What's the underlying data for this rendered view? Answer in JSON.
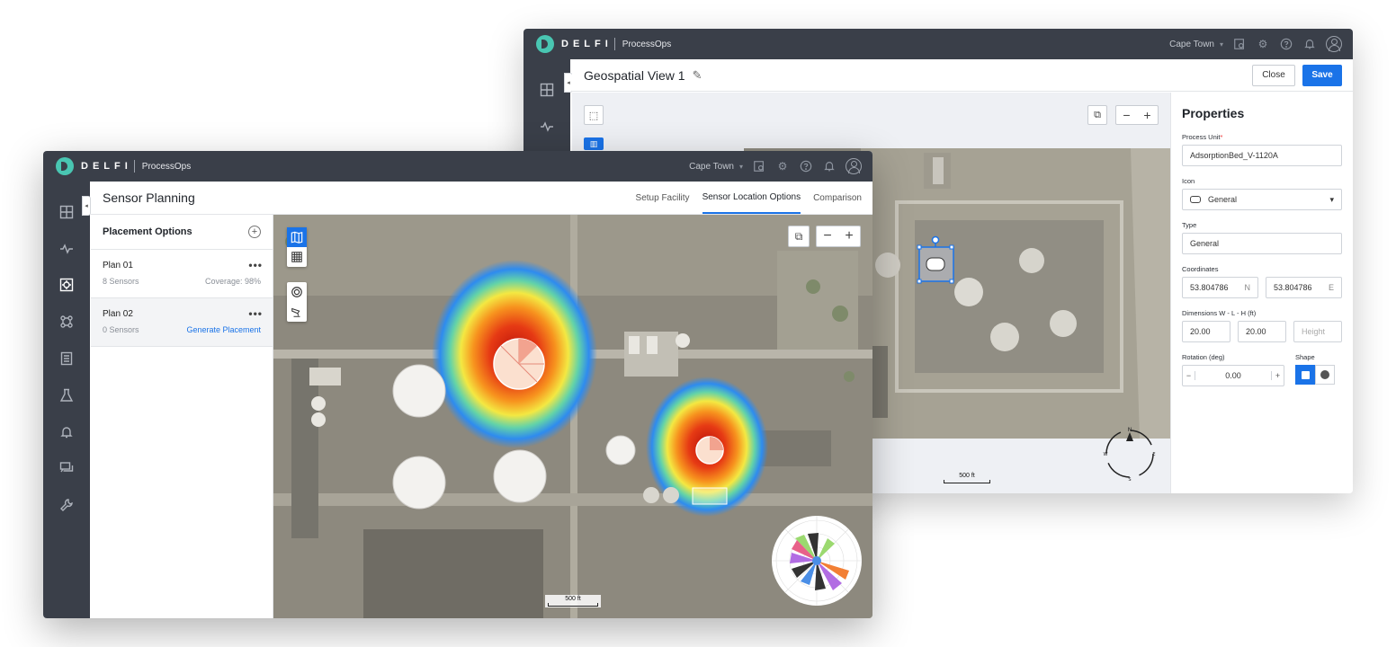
{
  "app": {
    "brand": "DELFI",
    "product": "ProcessOps",
    "site": "Cape Town"
  },
  "geo": {
    "title": "Geospatial View 1",
    "close_label": "Close",
    "save_label": "Save",
    "scale_label": "500 ft",
    "compass": {
      "n": "N",
      "s": "S",
      "e": "E",
      "w": "W"
    },
    "properties": {
      "title": "Properties",
      "process_unit_label": "Process Unit",
      "process_unit_value": "AdsorptionBed_V-1120A",
      "icon_label": "Icon",
      "icon_value": "General",
      "type_label": "Type",
      "type_value": "General",
      "coordinates_label": "Coordinates",
      "coord_n_value": "53.804786",
      "coord_n_unit": "N",
      "coord_e_value": "53.804786",
      "coord_e_unit": "E",
      "dimensions_label": "Dimensions W - L - H (ft)",
      "width_value": "20.00",
      "length_value": "20.00",
      "height_placeholder": "Height",
      "rotation_label": "Rotation (deg)",
      "rotation_value": "0.00",
      "shape_label": "Shape"
    }
  },
  "sensor": {
    "title": "Sensor Planning",
    "tabs": [
      {
        "label": "Setup Facility"
      },
      {
        "label": "Sensor Location Options",
        "active": true
      },
      {
        "label": "Comparison"
      }
    ],
    "placement": {
      "title": "Placement Options",
      "plans": [
        {
          "name": "Plan 01",
          "sensors": "8 Sensors",
          "right": "Coverage: 98%"
        },
        {
          "name": "Plan 02",
          "sensors": "0 Sensors",
          "right": "Generate Placement"
        }
      ]
    },
    "scale_label": "500 ft"
  },
  "colors": {
    "topbar": "#3a3f49",
    "accent": "#1a73e8",
    "logo": "#49c6b2"
  }
}
